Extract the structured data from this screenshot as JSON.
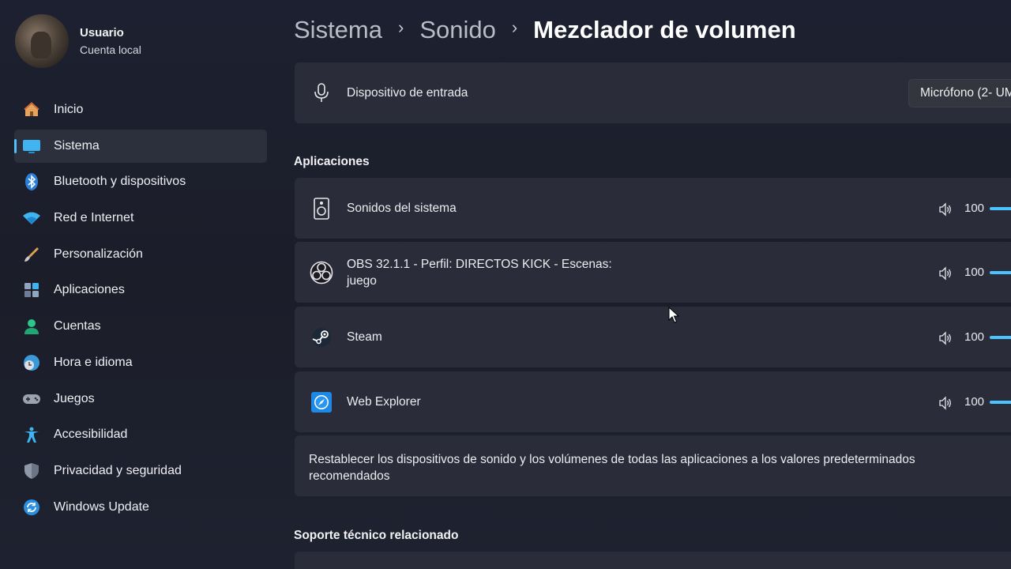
{
  "profile": {
    "name": "Usuario",
    "account_type": "Cuenta local"
  },
  "sidebar": {
    "items": [
      {
        "label": "Inicio",
        "icon": "home-icon",
        "active": false
      },
      {
        "label": "Sistema",
        "icon": "monitor-icon",
        "active": true
      },
      {
        "label": "Bluetooth y dispositivos",
        "icon": "bluetooth-icon",
        "active": false
      },
      {
        "label": "Red e Internet",
        "icon": "wifi-icon",
        "active": false
      },
      {
        "label": "Personalización",
        "icon": "brush-icon",
        "active": false
      },
      {
        "label": "Aplicaciones",
        "icon": "apps-icon",
        "active": false
      },
      {
        "label": "Cuentas",
        "icon": "person-icon",
        "active": false
      },
      {
        "label": "Hora e idioma",
        "icon": "clock-globe-icon",
        "active": false
      },
      {
        "label": "Juegos",
        "icon": "gamepad-icon",
        "active": false
      },
      {
        "label": "Accesibilidad",
        "icon": "accessibility-icon",
        "active": false
      },
      {
        "label": "Privacidad y seguridad",
        "icon": "shield-icon",
        "active": false
      },
      {
        "label": "Windows Update",
        "icon": "update-icon",
        "active": false
      }
    ]
  },
  "breadcrumb": {
    "parts": [
      "Sistema",
      "Sonido"
    ],
    "separator": "›",
    "current": "Mezclador de volumen"
  },
  "input_device": {
    "label": "Dispositivo de entrada",
    "selected": "Micrófono (2- UM"
  },
  "applications": {
    "title": "Aplicaciones",
    "items": [
      {
        "name": "Sonidos del sistema",
        "icon": "speaker-icon",
        "volume": "100",
        "volume_fraction": 1.0
      },
      {
        "name": "OBS 32.1.1 - Perfil: DIRECTOS KICK - Escenas: juego",
        "icon": "obs-icon",
        "volume": "100",
        "volume_fraction": 1.0
      },
      {
        "name": "Steam",
        "icon": "steam-icon",
        "volume": "100",
        "volume_fraction": 1.0
      },
      {
        "name": "Web Explorer",
        "icon": "browser-icon",
        "volume": "100",
        "volume_fraction": 1.0
      }
    ]
  },
  "reset": {
    "text": "Restablecer los dispositivos de sonido y los volúmenes de todas las aplicaciones a los valores predeterminados recomendados"
  },
  "related_support": {
    "title": "Soporte técnico relacionado"
  },
  "colors": {
    "accent": "#4cc2ff",
    "background": "#1c1f2a",
    "card": "#2a2d39"
  }
}
